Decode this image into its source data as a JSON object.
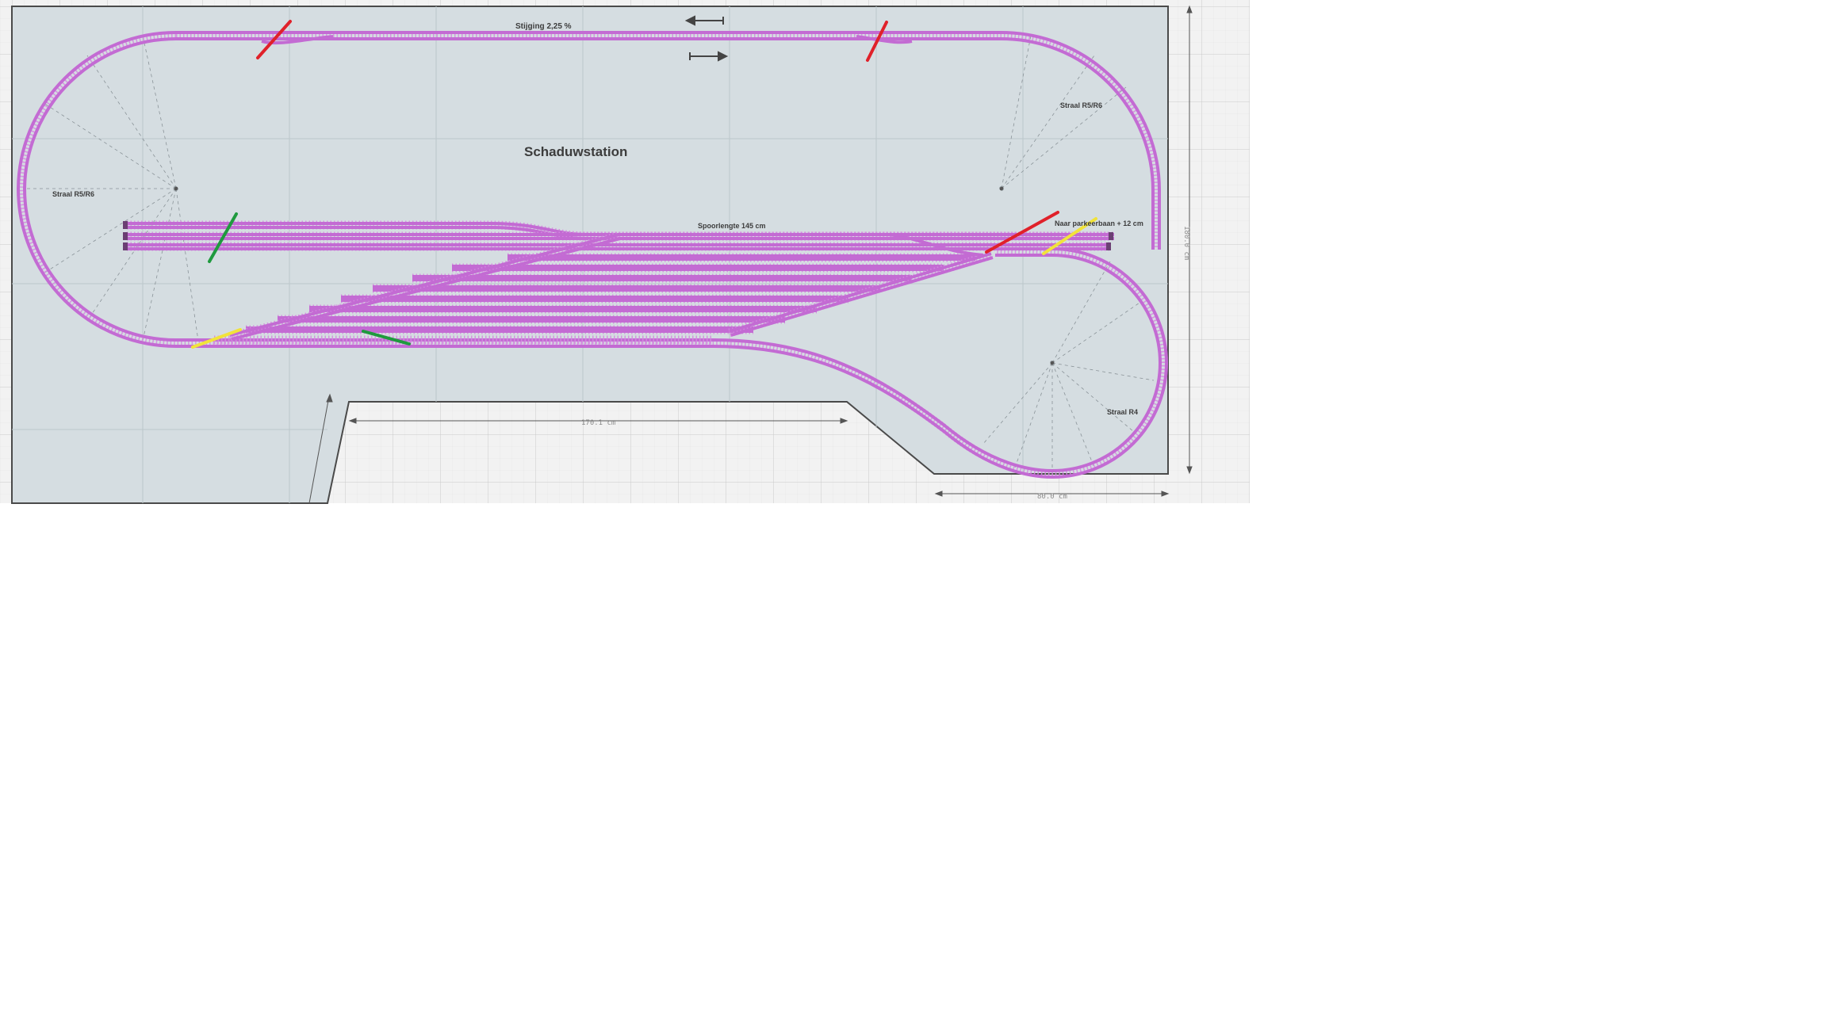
{
  "layout": {
    "title": "Schaduwstation",
    "gradient_label": "Stijging 2,25 %",
    "track_length_label": "Spoorlengte 145 cm",
    "exit_label": "Naar parkeerbaan + 12 cm",
    "radius_left": "Straal R5/R6",
    "radius_right_top": "Straal R5/R6",
    "radius_right_bottom": "Straal R4",
    "dim_width_top": "170.1 cm",
    "dim_width_bottom": "80.0 cm",
    "dim_height": "180.0 cm",
    "arrow_upper": "←",
    "arrow_lower": "→"
  },
  "colors": {
    "track": "#c36bd3",
    "board": "#d5dde1",
    "grid_bg": "#f2f2f2",
    "marker_red": "#e0212a",
    "marker_green": "#1f9a3e",
    "marker_yellow": "#f1e33a"
  }
}
